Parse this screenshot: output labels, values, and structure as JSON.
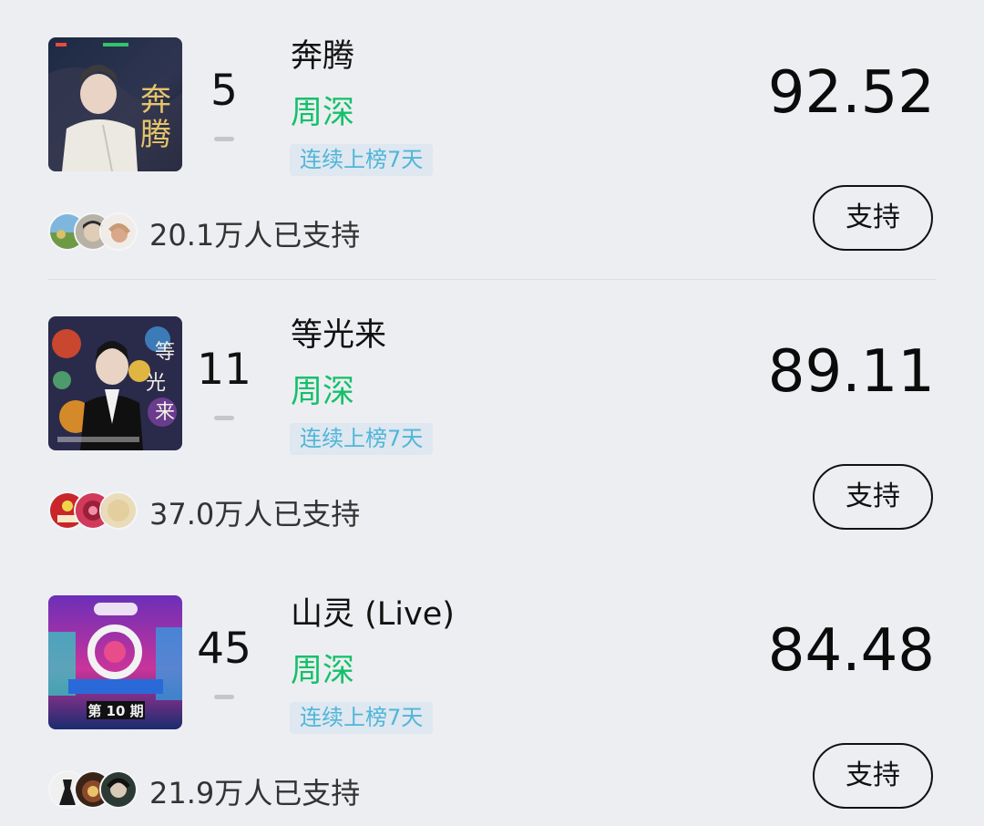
{
  "songs": [
    {
      "rank": "5",
      "title": "奔腾",
      "singer": "周深",
      "streak": "连续上榜7天",
      "score": "92.52",
      "supporters": "20.1万人已支持",
      "button": "支持",
      "cover_text": "奔腾"
    },
    {
      "rank": "11",
      "title": "等光来",
      "singer": "周深",
      "streak": "连续上榜7天",
      "score": "89.11",
      "supporters": "37.0万人已支持",
      "button": "支持",
      "cover_text": "等光来"
    },
    {
      "rank": "45",
      "title": "山灵 (Live)",
      "singer": "周深",
      "streak": "连续上榜7天",
      "score": "84.48",
      "supporters": "21.9万人已支持",
      "button": "支持",
      "cover_text": "第10期"
    }
  ],
  "colors": {
    "background": "#edeef2",
    "singer": "#14c06a",
    "streak_text": "#4fb6d8",
    "streak_bg": "#dfe7f0"
  },
  "icons": {
    "rank_change": "dash-icon"
  }
}
